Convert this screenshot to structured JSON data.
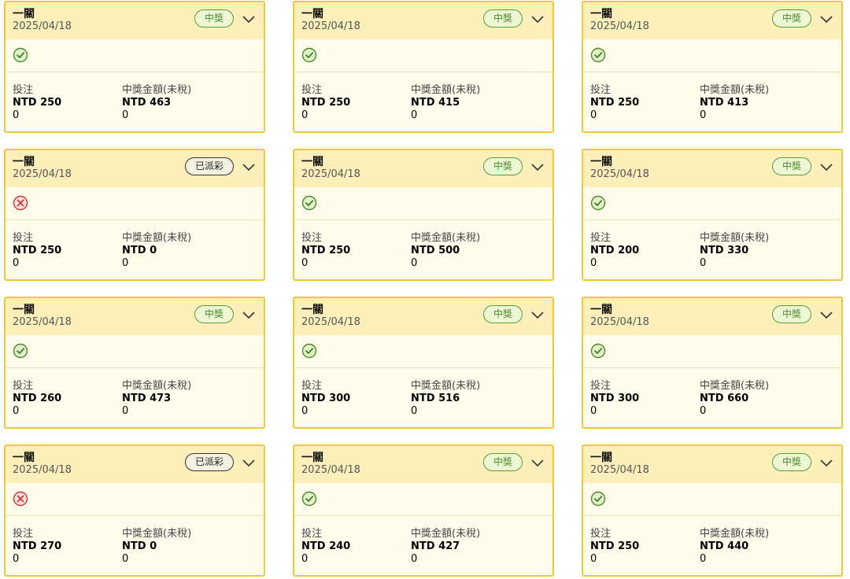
{
  "labels": {
    "bet": "投注",
    "prize": "中獎金額(未稅)"
  },
  "colors": {
    "border": "#f0c935",
    "header_bg": "#fcefba",
    "body_bg": "#fffcec",
    "win": "#5a9c37",
    "loss": "#d0342c"
  },
  "cards": [
    {
      "game": "一關",
      "date": "2025/04/18",
      "badge": "中獎",
      "badge_type": "win",
      "status_icon": "check-circle-icon",
      "bet": "NTD 250",
      "prize": "NTD 463",
      "bet_extra": "0",
      "prize_extra": "0"
    },
    {
      "game": "一關",
      "date": "2025/04/18",
      "badge": "中獎",
      "badge_type": "win",
      "status_icon": "check-circle-icon",
      "bet": "NTD 250",
      "prize": "NTD 415",
      "bet_extra": "0",
      "prize_extra": "0"
    },
    {
      "game": "一關",
      "date": "2025/04/18",
      "badge": "中獎",
      "badge_type": "win",
      "status_icon": "check-circle-icon",
      "bet": "NTD 250",
      "prize": "NTD 413",
      "bet_extra": "0",
      "prize_extra": "0"
    },
    {
      "game": "一關",
      "date": "2025/04/18",
      "badge": "已派彩",
      "badge_type": "paid",
      "status_icon": "x-circle-icon",
      "bet": "NTD 250",
      "prize": "NTD 0",
      "bet_extra": "0",
      "prize_extra": "0"
    },
    {
      "game": "一關",
      "date": "2025/04/18",
      "badge": "中獎",
      "badge_type": "win",
      "status_icon": "check-circle-icon",
      "bet": "NTD 250",
      "prize": "NTD 500",
      "bet_extra": "0",
      "prize_extra": "0"
    },
    {
      "game": "一關",
      "date": "2025/04/18",
      "badge": "中獎",
      "badge_type": "win",
      "status_icon": "check-circle-icon",
      "bet": "NTD 200",
      "prize": "NTD 330",
      "bet_extra": "0",
      "prize_extra": "0"
    },
    {
      "game": "一關",
      "date": "2025/04/18",
      "badge": "中獎",
      "badge_type": "win",
      "status_icon": "check-circle-icon",
      "bet": "NTD 260",
      "prize": "NTD 473",
      "bet_extra": "0",
      "prize_extra": "0"
    },
    {
      "game": "一關",
      "date": "2025/04/18",
      "badge": "中獎",
      "badge_type": "win",
      "status_icon": "check-circle-icon",
      "bet": "NTD 300",
      "prize": "NTD 516",
      "bet_extra": "0",
      "prize_extra": "0"
    },
    {
      "game": "一關",
      "date": "2025/04/18",
      "badge": "中獎",
      "badge_type": "win",
      "status_icon": "check-circle-icon",
      "bet": "NTD 300",
      "prize": "NTD 660",
      "bet_extra": "0",
      "prize_extra": "0"
    },
    {
      "game": "一關",
      "date": "2025/04/18",
      "badge": "已派彩",
      "badge_type": "paid",
      "status_icon": "x-circle-icon",
      "bet": "NTD 270",
      "prize": "NTD 0",
      "bet_extra": "0",
      "prize_extra": "0"
    },
    {
      "game": "一關",
      "date": "2025/04/18",
      "badge": "中獎",
      "badge_type": "win",
      "status_icon": "check-circle-icon",
      "bet": "NTD 240",
      "prize": "NTD 427",
      "bet_extra": "0",
      "prize_extra": "0"
    },
    {
      "game": "一關",
      "date": "2025/04/18",
      "badge": "中獎",
      "badge_type": "win",
      "status_icon": "check-circle-icon",
      "bet": "NTD 250",
      "prize": "NTD 440",
      "bet_extra": "0",
      "prize_extra": "0"
    }
  ]
}
